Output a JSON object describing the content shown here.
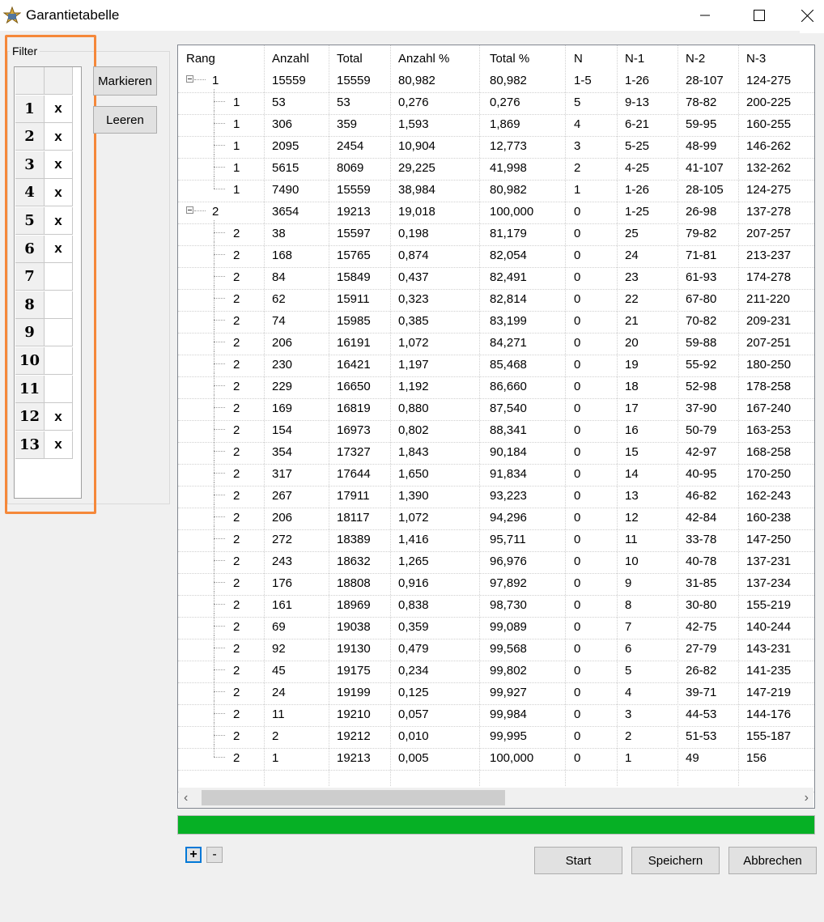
{
  "window": {
    "title": "Garantietabelle"
  },
  "filter": {
    "label": "Filter",
    "header": [
      "",
      ""
    ],
    "rows": [
      {
        "num": "1",
        "mark": "x"
      },
      {
        "num": "2",
        "mark": "x"
      },
      {
        "num": "3",
        "mark": "x"
      },
      {
        "num": "4",
        "mark": "x"
      },
      {
        "num": "5",
        "mark": "x"
      },
      {
        "num": "6",
        "mark": "x"
      },
      {
        "num": "7",
        "mark": ""
      },
      {
        "num": "8",
        "mark": ""
      },
      {
        "num": "9",
        "mark": ""
      },
      {
        "num": "10",
        "mark": ""
      },
      {
        "num": "11",
        "mark": ""
      },
      {
        "num": "12",
        "mark": "x"
      },
      {
        "num": "13",
        "mark": "x"
      }
    ],
    "mark_button": "Markieren",
    "clear_button": "Leeren"
  },
  "table": {
    "columns": [
      "Rang",
      "Anzahl",
      "Total",
      "Anzahl %",
      "Total %",
      "N",
      "N-1",
      "N-2",
      "N-3"
    ],
    "rows": [
      {
        "level": 0,
        "rang": "1",
        "anzahl": "15559",
        "total": "15559",
        "anzahl_pct": "80,982",
        "total_pct": "80,982",
        "n": "1-5",
        "n1": "1-26",
        "n2": "28-107",
        "n3": "124-275"
      },
      {
        "level": 1,
        "rang": "1",
        "anzahl": "53",
        "total": "53",
        "anzahl_pct": "0,276",
        "total_pct": "0,276",
        "n": "5",
        "n1": "9-13",
        "n2": "78-82",
        "n3": "200-225"
      },
      {
        "level": 1,
        "rang": "1",
        "anzahl": "306",
        "total": "359",
        "anzahl_pct": "1,593",
        "total_pct": "1,869",
        "n": "4",
        "n1": "6-21",
        "n2": "59-95",
        "n3": "160-255"
      },
      {
        "level": 1,
        "rang": "1",
        "anzahl": "2095",
        "total": "2454",
        "anzahl_pct": "10,904",
        "total_pct": "12,773",
        "n": "3",
        "n1": "5-25",
        "n2": "48-99",
        "n3": "146-262"
      },
      {
        "level": 1,
        "rang": "1",
        "anzahl": "5615",
        "total": "8069",
        "anzahl_pct": "29,225",
        "total_pct": "41,998",
        "n": "2",
        "n1": "4-25",
        "n2": "41-107",
        "n3": "132-262"
      },
      {
        "level": 1,
        "rang": "1",
        "anzahl": "7490",
        "total": "15559",
        "anzahl_pct": "38,984",
        "total_pct": "80,982",
        "n": "1",
        "n1": "1-26",
        "n2": "28-105",
        "n3": "124-275",
        "last": true
      },
      {
        "level": 0,
        "rang": "2",
        "anzahl": "3654",
        "total": "19213",
        "anzahl_pct": "19,018",
        "total_pct": "100,000",
        "n": "0",
        "n1": "1-25",
        "n2": "26-98",
        "n3": "137-278"
      },
      {
        "level": 1,
        "rang": "2",
        "anzahl": "38",
        "total": "15597",
        "anzahl_pct": "0,198",
        "total_pct": "81,179",
        "n": "0",
        "n1": "25",
        "n2": "79-82",
        "n3": "207-257"
      },
      {
        "level": 1,
        "rang": "2",
        "anzahl": "168",
        "total": "15765",
        "anzahl_pct": "0,874",
        "total_pct": "82,054",
        "n": "0",
        "n1": "24",
        "n2": "71-81",
        "n3": "213-237"
      },
      {
        "level": 1,
        "rang": "2",
        "anzahl": "84",
        "total": "15849",
        "anzahl_pct": "0,437",
        "total_pct": "82,491",
        "n": "0",
        "n1": "23",
        "n2": "61-93",
        "n3": "174-278"
      },
      {
        "level": 1,
        "rang": "2",
        "anzahl": "62",
        "total": "15911",
        "anzahl_pct": "0,323",
        "total_pct": "82,814",
        "n": "0",
        "n1": "22",
        "n2": "67-80",
        "n3": "211-220"
      },
      {
        "level": 1,
        "rang": "2",
        "anzahl": "74",
        "total": "15985",
        "anzahl_pct": "0,385",
        "total_pct": "83,199",
        "n": "0",
        "n1": "21",
        "n2": "70-82",
        "n3": "209-231"
      },
      {
        "level": 1,
        "rang": "2",
        "anzahl": "206",
        "total": "16191",
        "anzahl_pct": "1,072",
        "total_pct": "84,271",
        "n": "0",
        "n1": "20",
        "n2": "59-88",
        "n3": "207-251"
      },
      {
        "level": 1,
        "rang": "2",
        "anzahl": "230",
        "total": "16421",
        "anzahl_pct": "1,197",
        "total_pct": "85,468",
        "n": "0",
        "n1": "19",
        "n2": "55-92",
        "n3": "180-250"
      },
      {
        "level": 1,
        "rang": "2",
        "anzahl": "229",
        "total": "16650",
        "anzahl_pct": "1,192",
        "total_pct": "86,660",
        "n": "0",
        "n1": "18",
        "n2": "52-98",
        "n3": "178-258"
      },
      {
        "level": 1,
        "rang": "2",
        "anzahl": "169",
        "total": "16819",
        "anzahl_pct": "0,880",
        "total_pct": "87,540",
        "n": "0",
        "n1": "17",
        "n2": "37-90",
        "n3": "167-240"
      },
      {
        "level": 1,
        "rang": "2",
        "anzahl": "154",
        "total": "16973",
        "anzahl_pct": "0,802",
        "total_pct": "88,341",
        "n": "0",
        "n1": "16",
        "n2": "50-79",
        "n3": "163-253"
      },
      {
        "level": 1,
        "rang": "2",
        "anzahl": "354",
        "total": "17327",
        "anzahl_pct": "1,843",
        "total_pct": "90,184",
        "n": "0",
        "n1": "15",
        "n2": "42-97",
        "n3": "168-258"
      },
      {
        "level": 1,
        "rang": "2",
        "anzahl": "317",
        "total": "17644",
        "anzahl_pct": "1,650",
        "total_pct": "91,834",
        "n": "0",
        "n1": "14",
        "n2": "40-95",
        "n3": "170-250"
      },
      {
        "level": 1,
        "rang": "2",
        "anzahl": "267",
        "total": "17911",
        "anzahl_pct": "1,390",
        "total_pct": "93,223",
        "n": "0",
        "n1": "13",
        "n2": "46-82",
        "n3": "162-243"
      },
      {
        "level": 1,
        "rang": "2",
        "anzahl": "206",
        "total": "18117",
        "anzahl_pct": "1,072",
        "total_pct": "94,296",
        "n": "0",
        "n1": "12",
        "n2": "42-84",
        "n3": "160-238"
      },
      {
        "level": 1,
        "rang": "2",
        "anzahl": "272",
        "total": "18389",
        "anzahl_pct": "1,416",
        "total_pct": "95,711",
        "n": "0",
        "n1": "11",
        "n2": "33-78",
        "n3": "147-250"
      },
      {
        "level": 1,
        "rang": "2",
        "anzahl": "243",
        "total": "18632",
        "anzahl_pct": "1,265",
        "total_pct": "96,976",
        "n": "0",
        "n1": "10",
        "n2": "40-78",
        "n3": "137-231"
      },
      {
        "level": 1,
        "rang": "2",
        "anzahl": "176",
        "total": "18808",
        "anzahl_pct": "0,916",
        "total_pct": "97,892",
        "n": "0",
        "n1": "9",
        "n2": "31-85",
        "n3": "137-234"
      },
      {
        "level": 1,
        "rang": "2",
        "anzahl": "161",
        "total": "18969",
        "anzahl_pct": "0,838",
        "total_pct": "98,730",
        "n": "0",
        "n1": "8",
        "n2": "30-80",
        "n3": "155-219"
      },
      {
        "level": 1,
        "rang": "2",
        "anzahl": "69",
        "total": "19038",
        "anzahl_pct": "0,359",
        "total_pct": "99,089",
        "n": "0",
        "n1": "7",
        "n2": "42-75",
        "n3": "140-244"
      },
      {
        "level": 1,
        "rang": "2",
        "anzahl": "92",
        "total": "19130",
        "anzahl_pct": "0,479",
        "total_pct": "99,568",
        "n": "0",
        "n1": "6",
        "n2": "27-79",
        "n3": "143-231"
      },
      {
        "level": 1,
        "rang": "2",
        "anzahl": "45",
        "total": "19175",
        "anzahl_pct": "0,234",
        "total_pct": "99,802",
        "n": "0",
        "n1": "5",
        "n2": "26-82",
        "n3": "141-235"
      },
      {
        "level": 1,
        "rang": "2",
        "anzahl": "24",
        "total": "19199",
        "anzahl_pct": "0,125",
        "total_pct": "99,927",
        "n": "0",
        "n1": "4",
        "n2": "39-71",
        "n3": "147-219"
      },
      {
        "level": 1,
        "rang": "2",
        "anzahl": "11",
        "total": "19210",
        "anzahl_pct": "0,057",
        "total_pct": "99,984",
        "n": "0",
        "n1": "3",
        "n2": "44-53",
        "n3": "144-176"
      },
      {
        "level": 1,
        "rang": "2",
        "anzahl": "2",
        "total": "19212",
        "anzahl_pct": "0,010",
        "total_pct": "99,995",
        "n": "0",
        "n1": "2",
        "n2": "51-53",
        "n3": "155-187"
      },
      {
        "level": 1,
        "rang": "2",
        "anzahl": "1",
        "total": "19213",
        "anzahl_pct": "0,005",
        "total_pct": "100,000",
        "n": "0",
        "n1": "1",
        "n2": "49",
        "n3": "156",
        "last": true
      }
    ]
  },
  "progress": {
    "value": 1.0,
    "color": "#06b025"
  },
  "footer": {
    "expand_label": "+",
    "collapse_label": "-",
    "start_button": "Start",
    "save_button": "Speichern",
    "cancel_button": "Abbrechen"
  },
  "colors": {
    "highlight": "#f5883a",
    "accent": "#0078d7"
  },
  "icons": {
    "app": "app-logo-icon",
    "minimize": "minimize-icon",
    "maximize": "maximize-icon",
    "close": "close-icon",
    "scroll_left": "chevron-left-icon",
    "scroll_right": "chevron-right-icon"
  }
}
